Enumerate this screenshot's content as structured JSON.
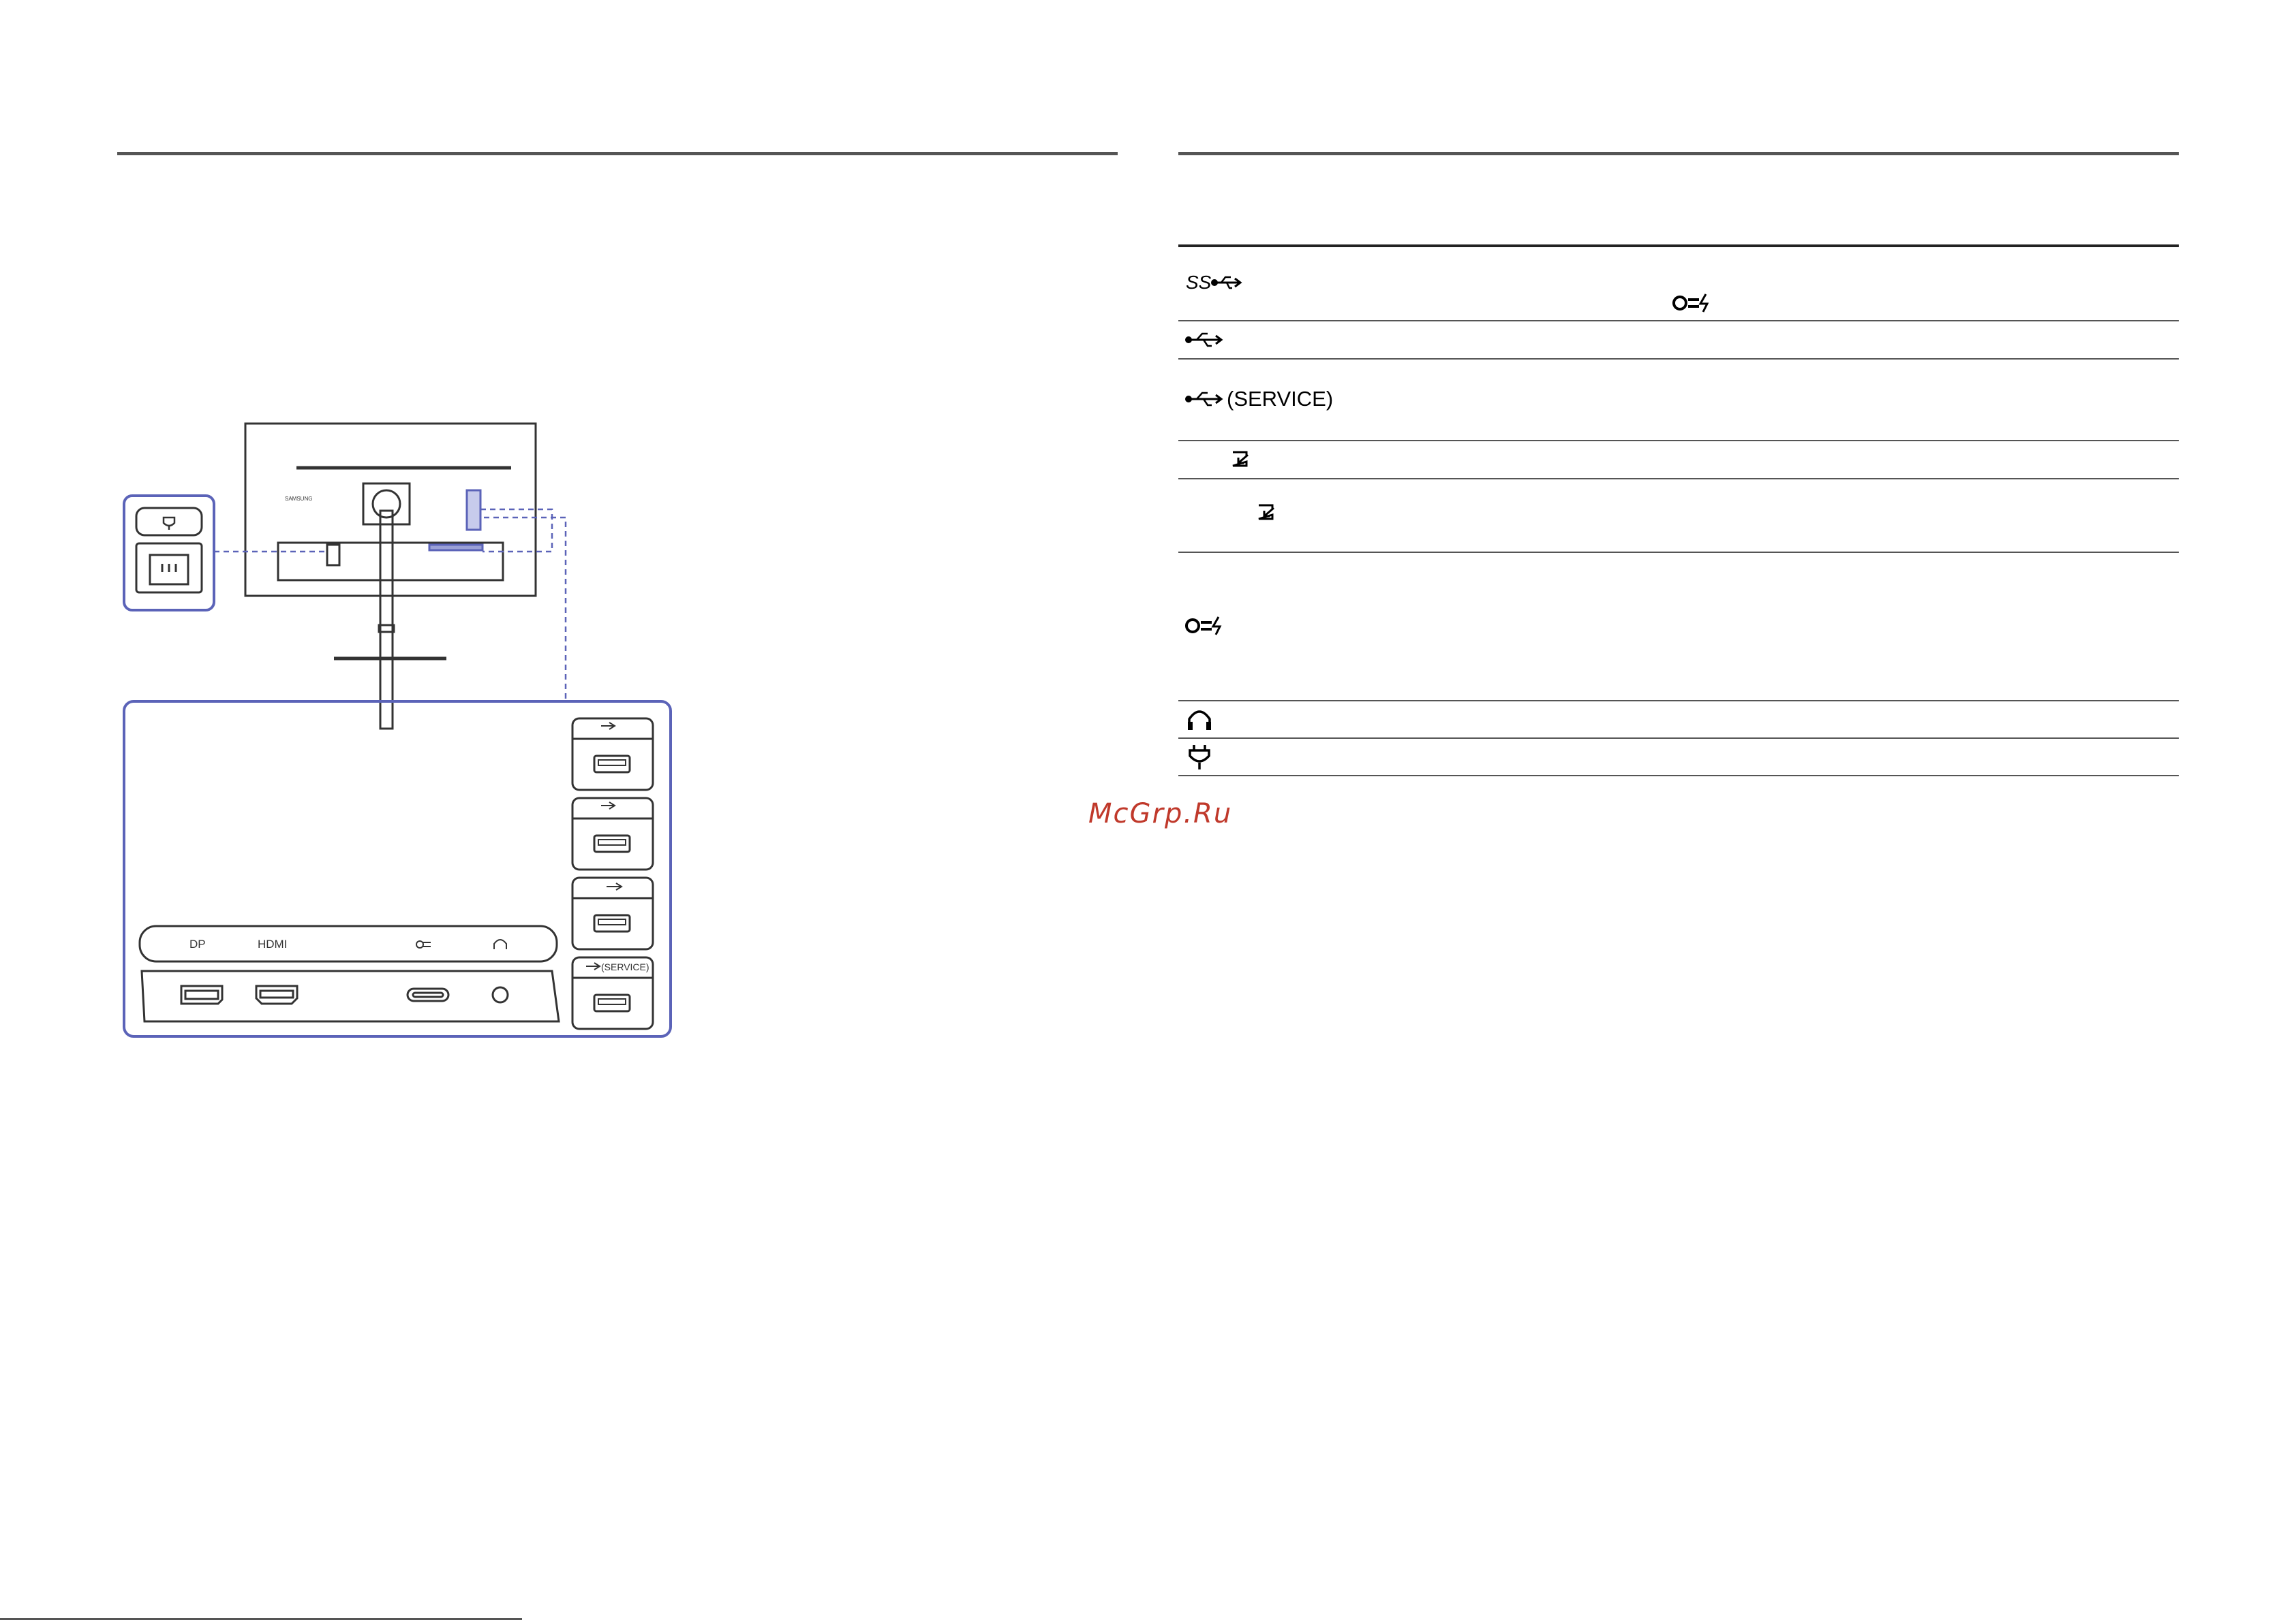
{
  "watermark": "McGrp.Ru",
  "diagram": {
    "brand_label": "SAMSUNG",
    "port_labels": {
      "dp": "DP",
      "hdmi": "HDMI",
      "usb_service": "(SERVICE)"
    },
    "accent_color": "#5b63b8"
  },
  "table": {
    "rows": [
      {
        "icon": "usb-superspeed-icon",
        "label": "",
        "note_icon": "usb-c-power-icon"
      },
      {
        "icon": "usb-icon",
        "label": ""
      },
      {
        "icon": "usb-icon",
        "label": "(SERVICE)"
      },
      {
        "icon": "input-icon",
        "label": ""
      },
      {
        "icon": "input-icon",
        "label": ""
      },
      {
        "icon": "usb-c-power-icon",
        "label": ""
      },
      {
        "icon": "headphone-icon",
        "label": ""
      },
      {
        "icon": "power-plug-icon",
        "label": ""
      }
    ]
  }
}
